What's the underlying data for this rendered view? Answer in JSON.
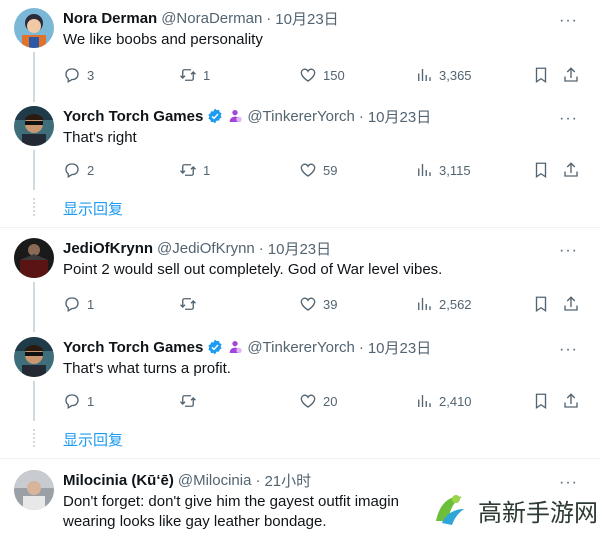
{
  "tweets": [
    {
      "name": "Nora Derman",
      "handle": "@NoraDerman",
      "date": "10月23日",
      "text": "We like boobs and personality",
      "replies": "3",
      "retweets": "1",
      "likes": "150",
      "views": "3,365"
    },
    {
      "name": "Yorch Torch Games",
      "handle": "@TinkererYorch",
      "date": "10月23日",
      "text": "That's right",
      "replies": "2",
      "retweets": "1",
      "likes": "59",
      "views": "3,115",
      "show_more": "显示回复"
    },
    {
      "name": "JediOfKrynn",
      "handle": "@JediOfKrynn",
      "date": "10月23日",
      "text": "Point 2 would sell out completely. God of War level vibes.",
      "replies": "1",
      "retweets": "",
      "likes": "39",
      "views": "2,562"
    },
    {
      "name": "Yorch Torch Games",
      "handle": "@TinkererYorch",
      "date": "10月23日",
      "text": "That's what turns a profit.",
      "replies": "1",
      "retweets": "",
      "likes": "20",
      "views": "2,410",
      "show_more": "显示回复"
    },
    {
      "name": "Milocinia (Kū‘ē)",
      "handle": "@Milocinia",
      "date": "21小时",
      "text_line1": "Don't forget: don't give him the gayest outfit imagin",
      "text_line2": "wearing looks like gay leather bondage."
    }
  ],
  "separator": "·",
  "more_glyph": "···",
  "watermark": {
    "text": "高新手游网"
  },
  "colors": {
    "link": "#1d9bf0",
    "verified": "#1d9bf0",
    "muted": "#536471",
    "affiliate": "#a146d9"
  }
}
